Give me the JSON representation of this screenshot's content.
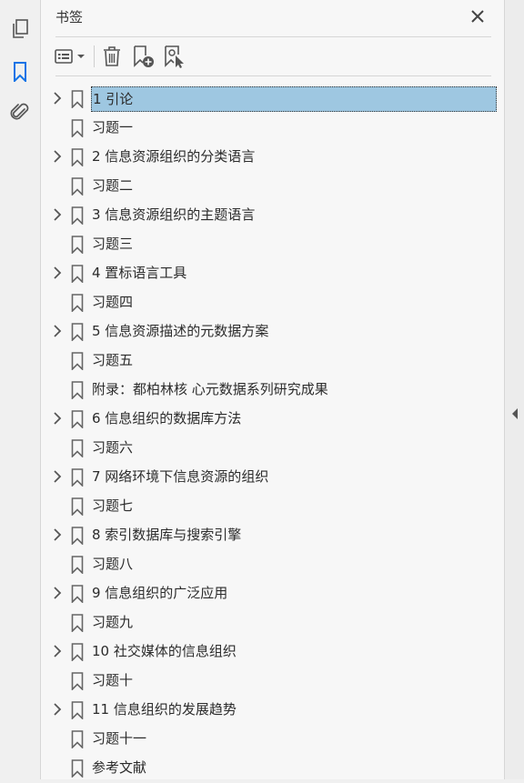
{
  "panel": {
    "title": "书签"
  },
  "bookmarks": [
    {
      "label": "1 引论",
      "expandable": true,
      "selected": true
    },
    {
      "label": "习题一",
      "expandable": false
    },
    {
      "label": "2 信息资源组织的分类语言",
      "expandable": true
    },
    {
      "label": "习题二",
      "expandable": false
    },
    {
      "label": "3 信息资源组织的主题语言",
      "expandable": true
    },
    {
      "label": "习题三",
      "expandable": false
    },
    {
      "label": "4 置标语言工具",
      "expandable": true
    },
    {
      "label": "习题四",
      "expandable": false
    },
    {
      "label": "5 信息资源描述的元数据方案",
      "expandable": true
    },
    {
      "label": "习题五",
      "expandable": false
    },
    {
      "label": "附录：都柏林核 心元数据系列研究成果",
      "expandable": false
    },
    {
      "label": "6 信息组织的数据库方法",
      "expandable": true
    },
    {
      "label": "习题六",
      "expandable": false
    },
    {
      "label": "7 网络环境下信息资源的组织",
      "expandable": true
    },
    {
      "label": "习题七",
      "expandable": false
    },
    {
      "label": "8 索引数据库与搜索引擎",
      "expandable": true
    },
    {
      "label": "习题八",
      "expandable": false
    },
    {
      "label": "9 信息组织的广泛应用",
      "expandable": true
    },
    {
      "label": "习题九",
      "expandable": false
    },
    {
      "label": "10 社交媒体的信息组织",
      "expandable": true
    },
    {
      "label": "习题十",
      "expandable": false
    },
    {
      "label": "11 信息组织的发展趋势",
      "expandable": true
    },
    {
      "label": "习题十一",
      "expandable": false
    },
    {
      "label": "参考文献",
      "expandable": false
    }
  ],
  "colors": {
    "selected": "#9ec7e1",
    "accent": "#1473e6",
    "icon": "#555555"
  },
  "icons": {
    "rail": [
      "pages-icon",
      "bookmark-icon",
      "attachment-icon"
    ],
    "toolbar": [
      "options-menu-icon",
      "delete-icon",
      "new-bookmark-icon",
      "new-bookmark-from-structure-icon"
    ]
  }
}
